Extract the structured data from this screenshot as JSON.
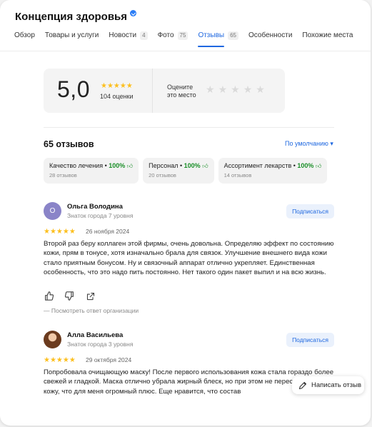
{
  "header": {
    "title": "Концепция здоровья"
  },
  "tabs": [
    {
      "label": "Обзор",
      "count": ""
    },
    {
      "label": "Товары и услуги",
      "count": ""
    },
    {
      "label": "Новости",
      "count": "4"
    },
    {
      "label": "Фото",
      "count": "75"
    },
    {
      "label": "Отзывы",
      "count": "65",
      "active": true
    },
    {
      "label": "Особенности",
      "count": ""
    },
    {
      "label": "Похожие места",
      "count": ""
    }
  ],
  "rating": {
    "value": "5,0",
    "stars": "★★★★★",
    "count_label": "104 оценки",
    "rate_prompt_line1": "Оцените",
    "rate_prompt_line2": "это место"
  },
  "reviews_section": {
    "count_label": "65 отзывов",
    "sort_label": "По умолчанию ▾"
  },
  "chips": [
    {
      "label": "Качество лечения",
      "percent": "100%",
      "sub": "28 отзывов"
    },
    {
      "label": "Персонал",
      "percent": "100%",
      "sub": "20 отзывов"
    },
    {
      "label": "Ассортимент лекарств",
      "percent": "100%",
      "sub": "14 отзывов"
    }
  ],
  "reviews": [
    {
      "avatar_letter": "О",
      "author": "Ольга Володина",
      "level": "Знаток города 7 уровня",
      "subscribe": "Подписаться",
      "stars": "★★★★★",
      "date": "26 ноября 2024",
      "text": "Второй раз беру коллаген этой фирмы, очень довольна. Определяю эффект по состоянию кожи, прям в тонусе, хотя изначально брала для связок. Улучшение внешнего вида кожи стало приятным бонусом. Ну и связочный аппарат отлично укрепляет. Единственная особенность, что это надо пить постоянно. Нет такого один пакет выпил и на всю жизнь.",
      "org_reply": "— Посмотреть ответ организации"
    },
    {
      "author": "Алла Васильева",
      "level": "Знаток города 3 уровня",
      "subscribe": "Подписаться",
      "stars": "★★★★★",
      "date": "29 октября 2024",
      "text": "Попробовала очищающую маску! После первого использования кожа стала гораздо более свежей и гладкой. Маска отлично убрала жирный блеск, но при этом не пересушивает кожу, что для меня огромный плюс. Еще нравится, что состав"
    }
  ],
  "write_review": {
    "label": "Написать отзыв"
  },
  "colors": {
    "accent": "#1f68e0",
    "star": "#fcbf1e",
    "positive": "#1a8f28"
  }
}
